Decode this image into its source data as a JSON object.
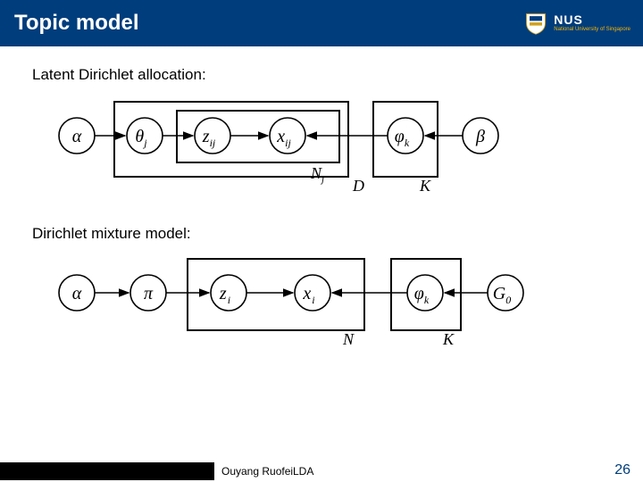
{
  "header": {
    "title": "Topic model",
    "logo": {
      "abbr": "NUS",
      "full": "National University of Singapore"
    }
  },
  "sections": {
    "lda_label": "Latent Dirichlet allocation:",
    "dmm_label": "Dirichlet mixture model:"
  },
  "lda": {
    "alpha": "α",
    "theta": "θ",
    "theta_sub": "j",
    "z": "z",
    "z_sub": "ij",
    "x": "x",
    "x_sub": "ij",
    "phi": "φ",
    "phi_sub": "k",
    "beta": "β",
    "plate_inner": "N",
    "plate_inner_sub": "j",
    "plate_outer": "D",
    "plate_right": "K"
  },
  "dmm": {
    "alpha": "α",
    "pi": "π",
    "z": "z",
    "z_sub": "i",
    "x": "x",
    "x_sub": "i",
    "phi": "φ",
    "phi_sub": "k",
    "G": "G",
    "G_sub": "0",
    "plate_n": "N",
    "plate_k": "K"
  },
  "footer": {
    "author": "Ouyang Ruofei",
    "topic": "LDA",
    "page": "26"
  }
}
